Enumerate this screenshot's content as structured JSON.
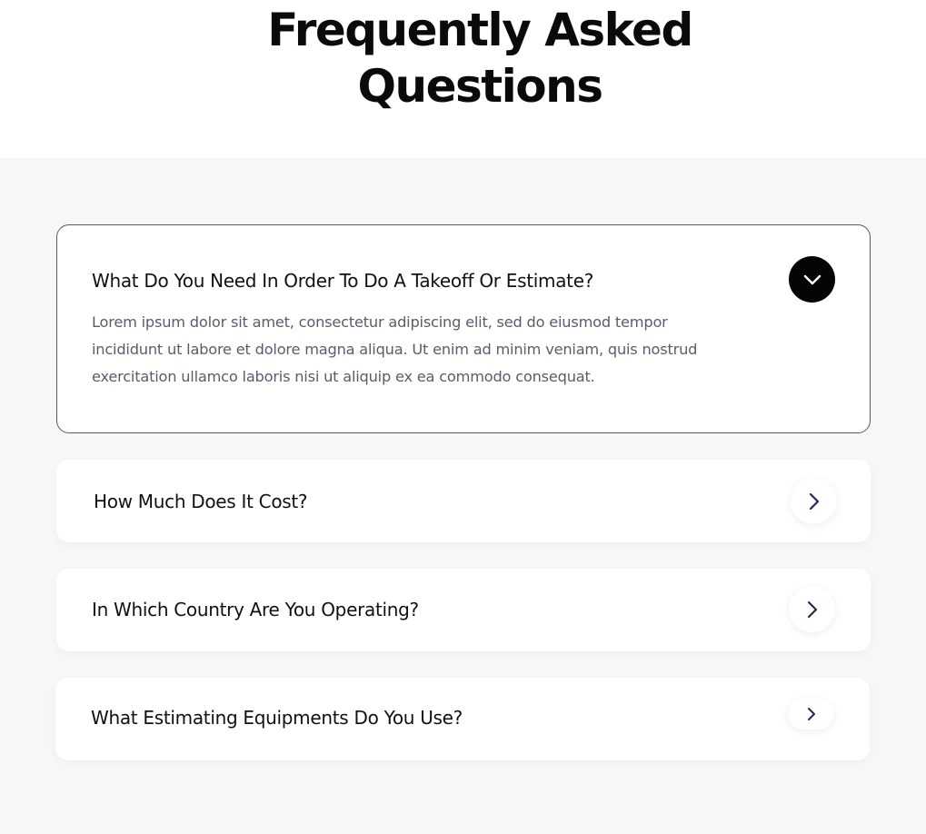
{
  "page": {
    "title_line1": "Frequently Asked",
    "title_line2": "Questions"
  },
  "faq": {
    "items": [
      {
        "question": "What Do You Need In Order To Do A Takeoff Or Estimate?",
        "answer_lines": [
          "Lorem ipsum dolor sit amet, consectetur adipiscing elit, sed do eiusmod tempor",
          "incididunt ut labore et dolore magna aliqua. Ut enim ad minim veniam, quis nostrud",
          "exercitation ullamco laboris nisi ut aliquip ex ea commodo consequat."
        ],
        "expanded": true,
        "toggle_icon": "chevron-down-icon"
      },
      {
        "question": "How Much Does It Cost?",
        "expanded": false,
        "toggle_icon": "chevron-right-icon"
      },
      {
        "question": "In Which Country Are You Operating?",
        "expanded": false,
        "toggle_icon": "chevron-right-icon"
      },
      {
        "question": "What Estimating Equipments Do You Use?",
        "expanded": false,
        "toggle_icon": "chevron-right-icon"
      }
    ]
  },
  "colors": {
    "section_background": "#f7f7f7",
    "card_background": "#ffffff",
    "heading_text": "#0a0a0a",
    "answer_text": "#5e5a6e",
    "open_toggle_background": "#050505",
    "chevron_accent": "#2c2552"
  }
}
